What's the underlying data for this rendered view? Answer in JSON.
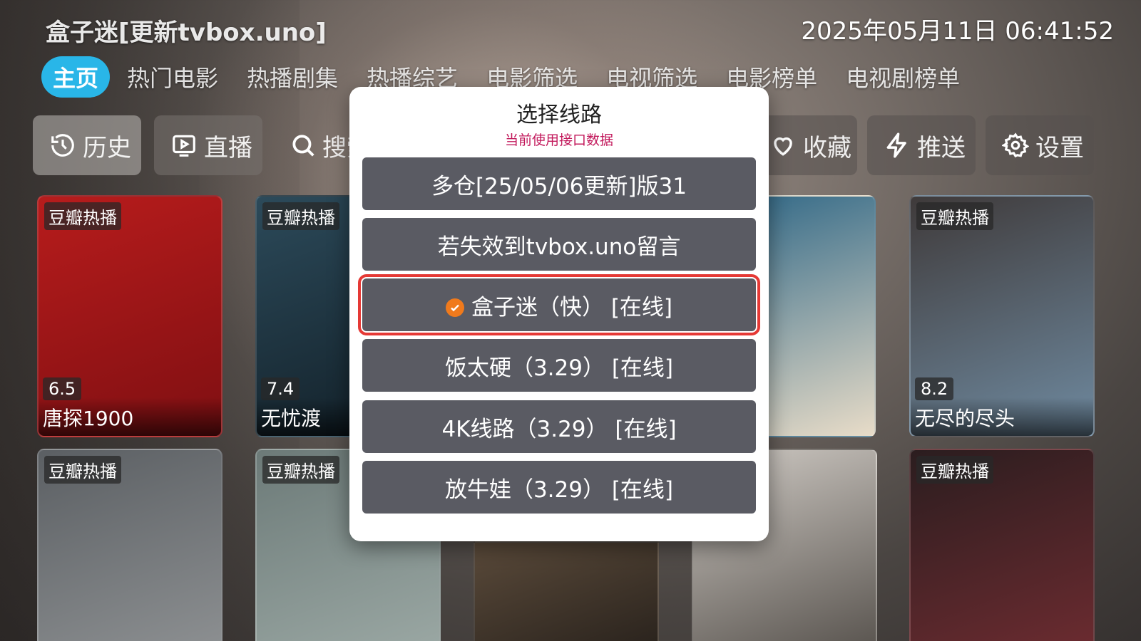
{
  "header": {
    "app_title": "盒子迷[更新tvbox.uno]",
    "datetime": "2025年05月11日 06:41:52"
  },
  "nav": {
    "tabs": [
      "主页",
      "热门电影",
      "热播剧集",
      "热播综艺",
      "电影筛选",
      "电视筛选",
      "电影榜单",
      "电视剧榜单"
    ]
  },
  "quick": {
    "history": "历史",
    "live": "直播",
    "search": "搜索",
    "favorites": "收藏",
    "push": "推送",
    "settings": "设置"
  },
  "cards": [
    {
      "badge": "豆瓣热播",
      "score": "6.5",
      "title": "唐探1900",
      "colors": [
        "#b71c1c",
        "#7f0f12"
      ]
    },
    {
      "badge": "豆瓣热播",
      "score": "7.4",
      "title": "无忧渡",
      "colors": [
        "#2c4a5a",
        "#14232c"
      ]
    },
    {
      "badge": "",
      "score": "",
      "title": "",
      "colors": [
        "#3a6e8a",
        "#e8dcc8"
      ]
    },
    {
      "badge": "豆瓣热播",
      "score": "8.2",
      "title": "无尽的尽头",
      "colors": [
        "#3f3a3a",
        "#6f8aa0"
      ]
    },
    {
      "badge": "豆瓣热播",
      "score": "",
      "title": "",
      "colors": [
        "#5b5f63",
        "#8c8f91"
      ]
    },
    {
      "badge": "豆瓣热播",
      "score": "",
      "title": "",
      "colors": [
        "#6c7a78",
        "#9aa7a3"
      ]
    },
    {
      "badge": "",
      "score": "",
      "title": "",
      "colors": [
        "#5a4a3a",
        "#2a231d"
      ]
    },
    {
      "badge": "",
      "score": "",
      "title": "",
      "colors": [
        "#cfcac4",
        "#5a5550"
      ]
    },
    {
      "badge": "豆瓣热播",
      "score": "",
      "title": "",
      "colors": [
        "#2b1d1f",
        "#6b2b30"
      ]
    }
  ],
  "dialog": {
    "title": "选择线路",
    "subtitle": "当前使用接口数据",
    "options": [
      {
        "label": "多仓[25/05/06更新]版31",
        "selected": false
      },
      {
        "label": "若失效到tvbox.uno留言",
        "selected": false
      },
      {
        "label": "盒子迷（快） [在线]",
        "selected": true
      },
      {
        "label": "饭太硬（3.29） [在线]",
        "selected": false
      },
      {
        "label": "4K线路（3.29） [在线]",
        "selected": false
      },
      {
        "label": "放牛娃（3.29） [在线]",
        "selected": false
      }
    ]
  },
  "colors": {
    "accent": "#29b6e8",
    "option_bg": "#5a5b63",
    "selected_outline": "#e53935",
    "check": "#f07a1c",
    "subtitle": "#c2185b"
  }
}
